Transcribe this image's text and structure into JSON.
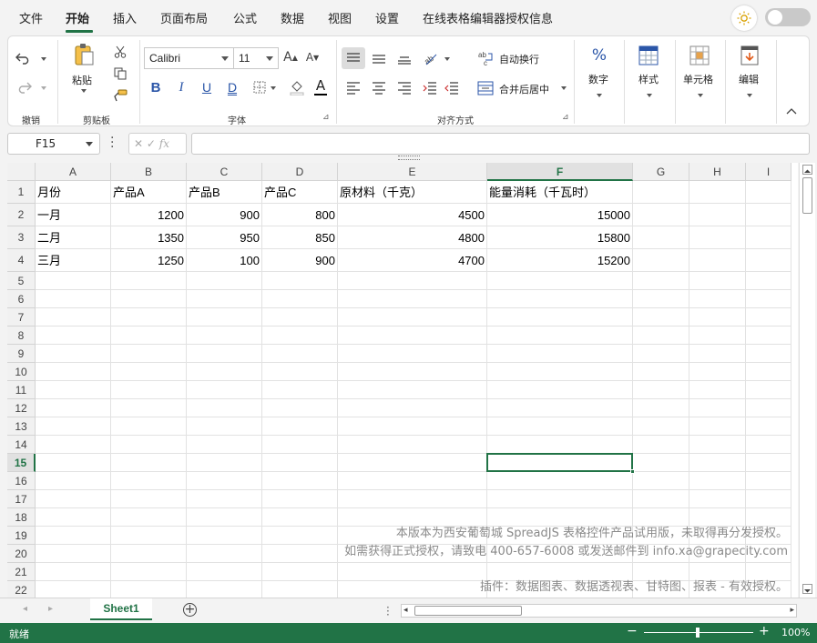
{
  "menu": {
    "items": [
      "文件",
      "开始",
      "插入",
      "页面布局",
      "公式",
      "数据",
      "视图",
      "设置",
      "在线表格编辑器授权信息"
    ],
    "active_index": 1
  },
  "ribbon": {
    "undo_group_label": "撤销",
    "clipboard": {
      "paste_label": "粘贴",
      "group_label": "剪贴板"
    },
    "font": {
      "family": "Calibri",
      "size": "11",
      "group_label": "字体"
    },
    "alignment": {
      "wrap_label": "自动换行",
      "merge_label": "合并后居中",
      "group_label": "对齐方式"
    },
    "number_label": "数字",
    "style_label": "样式",
    "cell_label": "单元格",
    "edit_label": "编辑"
  },
  "formula_bar": {
    "name_box": "F15",
    "fx": "fx",
    "value": ""
  },
  "columns": [
    "A",
    "B",
    "C",
    "D",
    "E",
    "F",
    "G",
    "H",
    "I"
  ],
  "selected_column": "F",
  "rows": [
    "1",
    "2",
    "3",
    "4",
    "5",
    "6",
    "7",
    "8",
    "9",
    "10",
    "11",
    "12",
    "13",
    "14",
    "15",
    "16",
    "17",
    "18",
    "19",
    "20",
    "21",
    "22"
  ],
  "selected_row": "15",
  "cells": [
    [
      "月份",
      "产品A",
      "产品B",
      "产品C",
      "原材料（千克）",
      "能量消耗（千瓦时）"
    ],
    [
      "一月",
      "1200",
      "900",
      "800",
      "4500",
      "15000"
    ],
    [
      "二月",
      "1350",
      "950",
      "850",
      "4800",
      "15800"
    ],
    [
      "三月",
      "1250",
      "100",
      "900",
      "4700",
      "15200"
    ]
  ],
  "watermark": {
    "line1": "本版本为西安葡萄城 SpreadJS 表格控件产品试用版，未取得再分发授权。",
    "line2": "如需获得正式授权，请致电 400-657-6008 或发送邮件到 info.xa@grapecity.com",
    "line3": "插件：数据图表、数据透视表、甘特图、报表 - 有效授权。"
  },
  "sheet_tab": "Sheet1",
  "status": {
    "ready": "就绪",
    "zoom": "100%"
  },
  "theme": {
    "accent": "#217346"
  }
}
